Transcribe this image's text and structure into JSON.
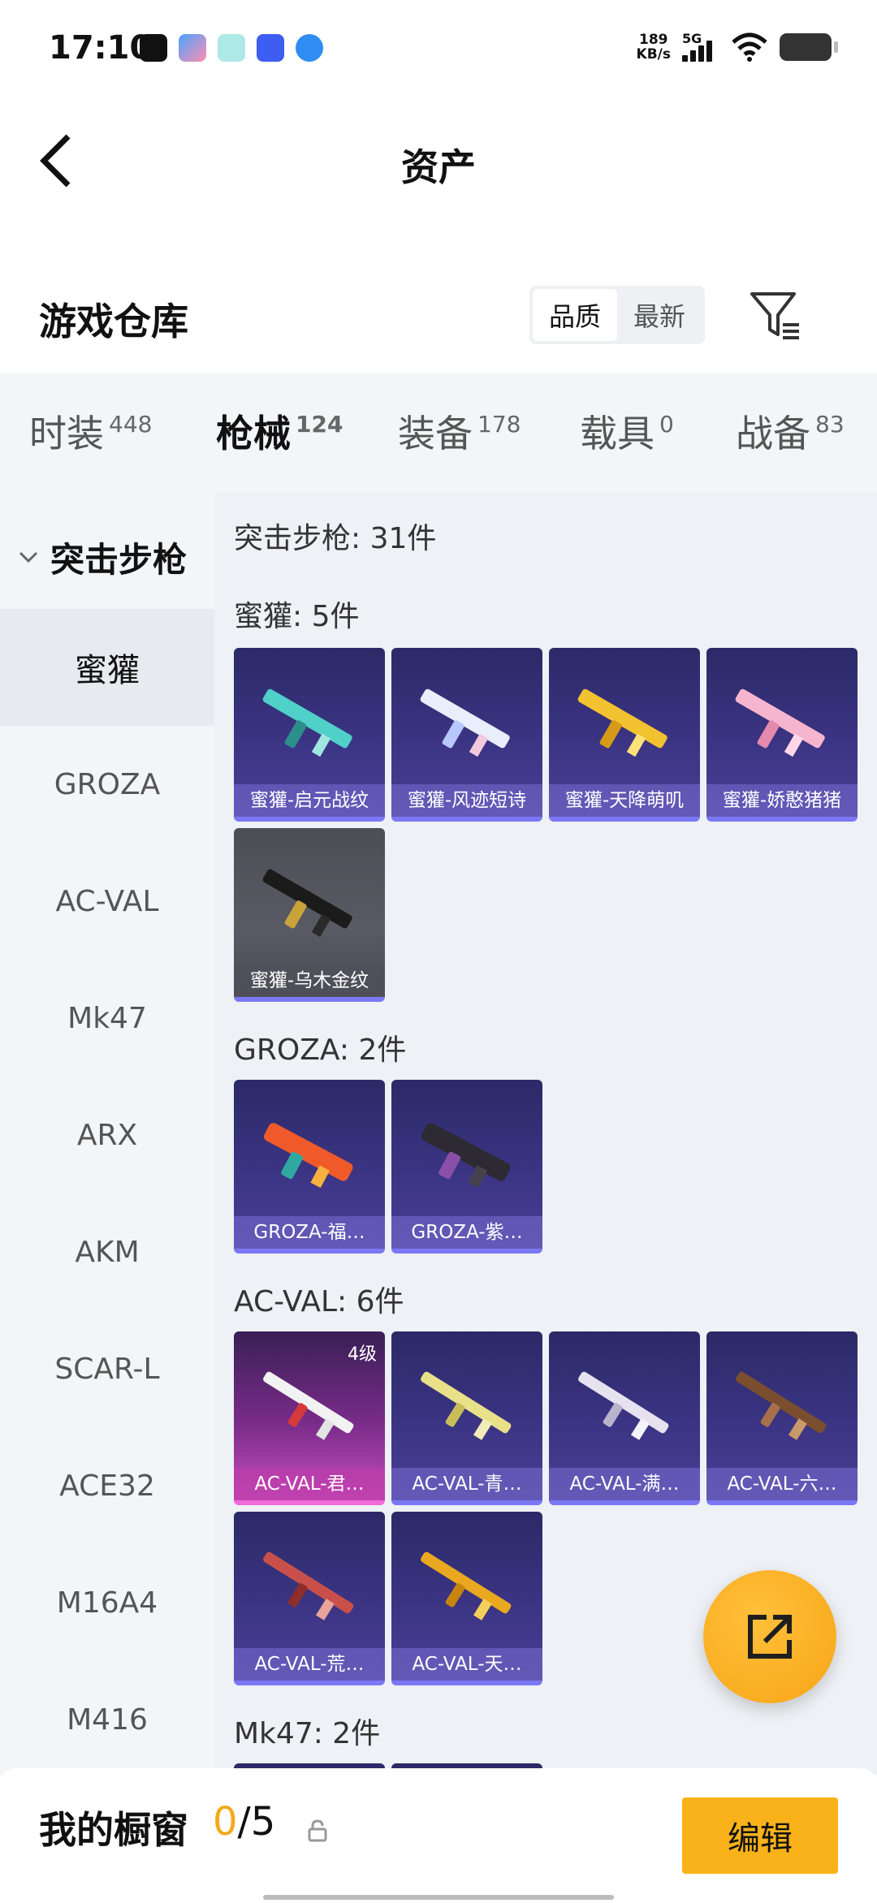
{
  "status_bar": {
    "time": "17:10",
    "net_speed_value": "189",
    "net_speed_unit": "KB/s",
    "network": "5G",
    "app_icons": [
      "tiktok-icon",
      "app-icon-blue",
      "app-icon-teal",
      "vivo-icon",
      "browser-icon"
    ]
  },
  "header": {
    "title": "资产",
    "back_icon": "back-arrow-icon"
  },
  "warehouse": {
    "title": "游戏仓库",
    "sort_options": [
      "品质",
      "最新"
    ],
    "sort_selected": "品质",
    "filter_icon": "filter-icon"
  },
  "category_tabs": [
    {
      "label": "时装",
      "count": "448"
    },
    {
      "label": "枪械",
      "count": "124",
      "active": true
    },
    {
      "label": "装备",
      "count": "178"
    },
    {
      "label": "载具",
      "count": "0"
    },
    {
      "label": "战备",
      "count": "83"
    }
  ],
  "sidebar": {
    "group_label": "突击步枪",
    "items": [
      "蜜獾",
      "GROZA",
      "AC-VAL",
      "Mk47",
      "ARX",
      "AKM",
      "SCAR-L",
      "ACE32",
      "M16A4",
      "M416"
    ],
    "active": "蜜獾"
  },
  "content": {
    "summary": "突击步枪: 31件",
    "sections": [
      {
        "title": "蜜獾: 5件",
        "items": [
          "蜜獾-启元战纹",
          "蜜獾-风迹短诗",
          "蜜獾-天降萌叽",
          "蜜獾-娇憨猪猪",
          "蜜獾-乌木金纹"
        ]
      },
      {
        "title": "GROZA: 2件",
        "items": [
          "GROZA-福…",
          "GROZA-紫…"
        ]
      },
      {
        "title": "AC-VAL: 6件",
        "items": [
          "AC-VAL-君…",
          "AC-VAL-青…",
          "AC-VAL-满…",
          "AC-VAL-六…",
          "AC-VAL-荒…",
          "AC-VAL-天…"
        ],
        "first_item_level": "4级"
      },
      {
        "title": "Mk47: 2件"
      }
    ]
  },
  "bottom_bar": {
    "label": "我的橱窗",
    "current": "0",
    "total": "/5",
    "edit_label": "编辑"
  },
  "colors": {
    "accent": "#f5a81c",
    "card_purple": "#3b3483",
    "card_border": "#7b78f5"
  }
}
